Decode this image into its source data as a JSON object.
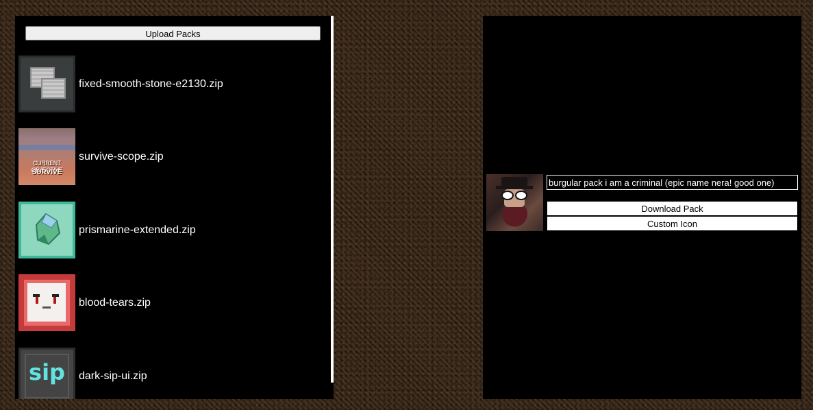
{
  "left_panel": {
    "upload_button_label": "Upload Packs",
    "packs": [
      {
        "name": "fixed-smooth-stone-e2130.zip",
        "icon": "smooth-stone-icon"
      },
      {
        "name": "survive-scope.zip",
        "icon": "survive-scope-icon"
      },
      {
        "name": "prismarine-extended.zip",
        "icon": "prismarine-icon"
      },
      {
        "name": "blood-tears.zip",
        "icon": "blood-tears-icon"
      },
      {
        "name": "dark-sip-ui.zip",
        "icon": "sip-icon"
      }
    ]
  },
  "icon_text": {
    "survive_subtitle": "CURRENT OBJECTIVE",
    "survive_title": "SURVIVE",
    "sip": "sip"
  },
  "right_panel": {
    "pack_name_value": "burgular pack i am a criminal (epic name nera! good one)",
    "download_button_label": "Download Pack",
    "custom_icon_button_label": "Custom Icon"
  },
  "colors": {
    "panel_background": "#000000",
    "page_background": "#3a2a1c",
    "text": "#ffffff"
  }
}
